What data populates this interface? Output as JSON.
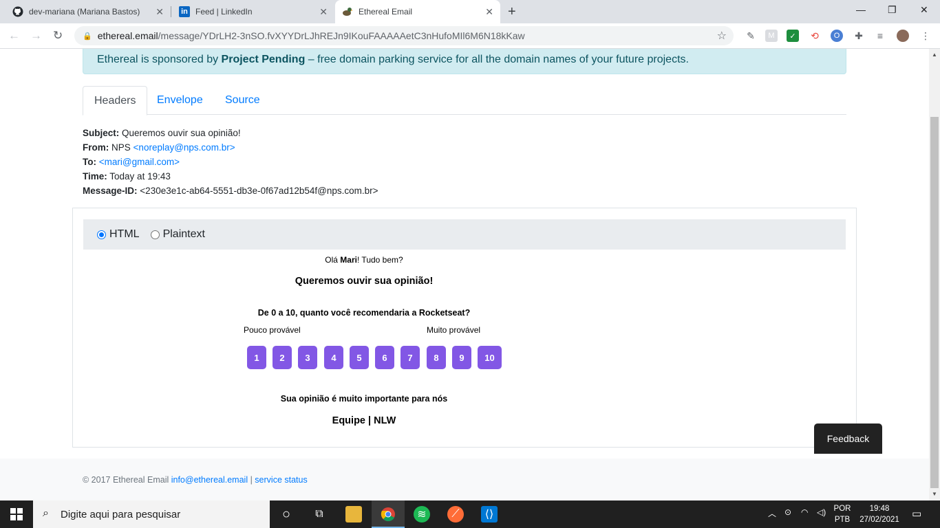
{
  "browser": {
    "tabs": [
      {
        "title": "dev-mariana (Mariana Bastos)",
        "icon": "github-icon"
      },
      {
        "title": "Feed | LinkedIn",
        "icon": "linkedin-icon"
      },
      {
        "title": "Ethereal Email",
        "icon": "ethereal-icon"
      }
    ],
    "url_host": "ethereal.email",
    "url_path": "/message/YDrLH2-3nSO.fvXYYDrLJhREJn9IKouFAAAAAetC3nHufoMIl6M6N18kKaw"
  },
  "sponsor": {
    "prefix": "Ethereal is sponsored by ",
    "name": "Project Pending",
    "suffix": " – free domain parking service for all the domain names of your future projects."
  },
  "tabs": {
    "headers": "Headers",
    "envelope": "Envelope",
    "source": "Source"
  },
  "headers": {
    "subject_label": "Subject:",
    "subject": "Queremos ouvir sua opinião!",
    "from_label": "From:",
    "from_name": "NPS",
    "from_email": "<noreplay@nps.com.br>",
    "to_label": "To:",
    "to_email": "<mari@gmail.com>",
    "time_label": "Time:",
    "time": "Today at 19:43",
    "message_id_label": "Message-ID:",
    "message_id": "<230e3e1c-ab64-5551-db3e-0f67ad12b54f@nps.com.br>"
  },
  "format": {
    "html": "HTML",
    "plaintext": "Plaintext",
    "selected": "HTML"
  },
  "email": {
    "greeting_prefix": "Olá ",
    "greeting_name": "Mari",
    "greeting_suffix": "! Tudo bem?",
    "title": "Queremos ouvir sua opinião!",
    "question": "De 0 a 10, quanto você recomendaria a Rocketseat?",
    "low_label": "Pouco provável",
    "high_label": "Muito provável",
    "scores": [
      "1",
      "2",
      "3",
      "4",
      "5",
      "6",
      "7",
      "8",
      "9",
      "10"
    ],
    "closing": "Sua opinião é muito importante para nós",
    "signature": "Equipe | NLW",
    "button_color": "#8257e5"
  },
  "footer": {
    "copyright": "© 2017 Ethereal Email ",
    "email_link": "info@ethereal.email",
    "separator": " | ",
    "status_link": "service status"
  },
  "feedback": "Feedback",
  "taskbar": {
    "search_placeholder": "Digite aqui para pesquisar",
    "lang_top": "POR",
    "lang_bottom": "PTB",
    "time": "19:48",
    "date": "27/02/2021"
  }
}
